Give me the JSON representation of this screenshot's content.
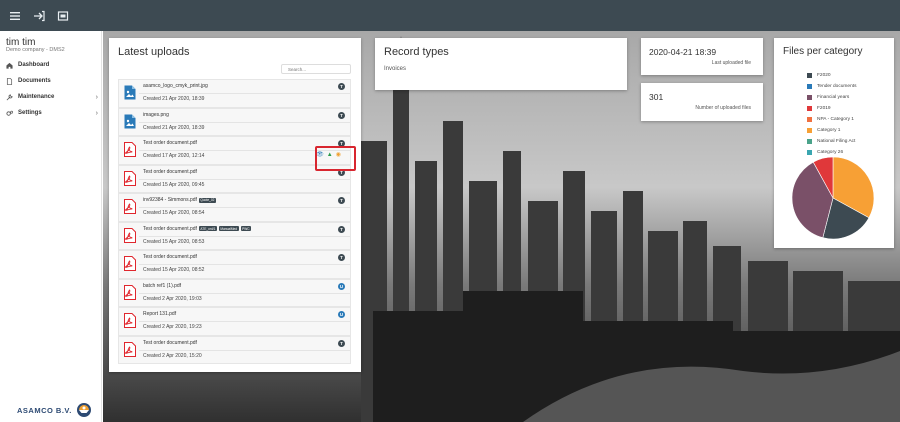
{
  "topbar": {
    "icons": [
      "menu-icon",
      "logout-icon",
      "window-icon"
    ]
  },
  "sidebar": {
    "user_name": "tim tim",
    "company": "Demo company - DMS2",
    "items": [
      {
        "label": "Dashboard",
        "icon": "home-icon",
        "has_chevron": false
      },
      {
        "label": "Documents",
        "icon": "document-icon",
        "has_chevron": false
      },
      {
        "label": "Maintenance",
        "icon": "wrench-icon",
        "has_chevron": true
      },
      {
        "label": "Settings",
        "icon": "gears-icon",
        "has_chevron": true
      }
    ],
    "chevron": "›",
    "logo_text": "ASAMCO B.V."
  },
  "uploads": {
    "title": "Latest uploads",
    "search_placeholder": "Search...",
    "items": [
      {
        "name": "asamco_logo_cmyk_print.jpg",
        "date": "Created 21 Apr 2020, 18:39",
        "type": "image",
        "badge": "T",
        "badge_color": "dark",
        "tags": []
      },
      {
        "name": "images.png",
        "date": "Created 21 Apr 2020, 18:39",
        "type": "image",
        "badge": "T",
        "badge_color": "dark",
        "tags": []
      },
      {
        "name": "Test order document.pdf",
        "date": "Created 17 Apr 2020, 12:14",
        "type": "pdf",
        "badge": "T",
        "badge_color": "dark",
        "tags": [],
        "actions": true
      },
      {
        "name": "Test order document.pdf",
        "date": "Created 15 Apr 2020, 09:45",
        "type": "pdf",
        "badge": "T",
        "badge_color": "dark",
        "tags": []
      },
      {
        "name": "inv92384 - Simmons.pdf",
        "date": "Created 15 Apr 2020, 08:54",
        "type": "pdf",
        "badge": "T",
        "badge_color": "dark",
        "tags": [
          "Quote_02"
        ]
      },
      {
        "name": "Test order document.pdf",
        "date": "Created 15 Apr 2020, 08:53",
        "type": "pdf",
        "badge": "T",
        "badge_color": "dark",
        "tags": [
          "ATE_ord/1",
          "ManualMed",
          "PWC"
        ]
      },
      {
        "name": "Test order document.pdf",
        "date": "Created 15 Apr 2020, 08:52",
        "type": "pdf",
        "badge": "T",
        "badge_color": "dark",
        "tags": []
      },
      {
        "name": "batch ref1 (1).pdf",
        "date": "Created 2 Apr 2020, 19:03",
        "type": "pdf",
        "badge": "U",
        "badge_color": "blue",
        "tags": []
      },
      {
        "name": "Report 131.pdf",
        "date": "Created 2 Apr 2020, 19:23",
        "type": "pdf",
        "badge": "U",
        "badge_color": "blue",
        "tags": []
      },
      {
        "name": "Test order document.pdf",
        "date": "Created 2 Apr 2020, 15:20",
        "type": "pdf",
        "badge": "T",
        "badge_color": "dark",
        "tags": []
      }
    ],
    "action_icons": [
      "eye-icon",
      "warning-icon",
      "download-icon"
    ]
  },
  "records": {
    "title": "Record types",
    "value": "Invoices"
  },
  "stats": {
    "last_uploaded_value": "2020-04-21 18:39",
    "last_uploaded_label": "Last uploaded file",
    "count_value": "301",
    "count_label": "Number of uploaded files"
  },
  "category": {
    "title": "Files per category"
  },
  "chart_data": {
    "type": "pie",
    "title": "Files per category",
    "categories": [
      "F2020",
      "Tender documents",
      "Financial years",
      "F2019",
      "NPA - Category 1",
      "Category 1",
      "National Filing Act",
      "Category 26"
    ],
    "values": [
      0,
      0,
      38,
      8,
      0,
      33,
      0,
      0
    ],
    "colors": [
      "#3d4a52",
      "#2a7ab8",
      "#7a5068",
      "#e0383a",
      "#f07040",
      "#f7a035",
      "#4aa38a",
      "#3aa6b0"
    ],
    "other_value": 21,
    "other_color": "#3d4a52",
    "legend_placement": "top"
  }
}
